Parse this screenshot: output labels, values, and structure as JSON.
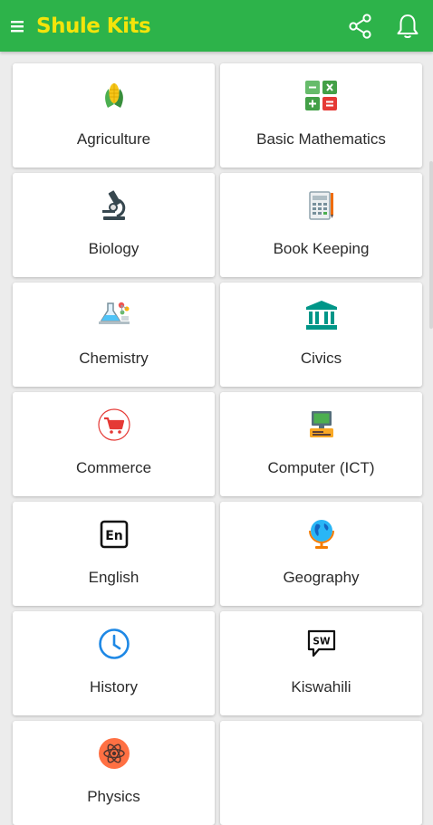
{
  "app": {
    "title": "Shule Kits",
    "brand_color": "#2db34a",
    "title_color": "#f4e40b"
  },
  "toolbar": {
    "menu_icon": "hamburger-menu-icon",
    "share_icon": "share-icon",
    "bell_icon": "bell-icon"
  },
  "subjects": [
    {
      "label": "Agriculture",
      "icon": "corn-icon"
    },
    {
      "label": "Basic Mathematics",
      "icon": "math-operators-icon"
    },
    {
      "label": "Biology",
      "icon": "microscope-icon"
    },
    {
      "label": "Book Keeping",
      "icon": "ledger-icon"
    },
    {
      "label": "Chemistry",
      "icon": "chemistry-flask-icon"
    },
    {
      "label": "Civics",
      "icon": "government-building-icon"
    },
    {
      "label": "Commerce",
      "icon": "shopping-cart-icon"
    },
    {
      "label": "Computer (ICT)",
      "icon": "computer-icon"
    },
    {
      "label": "English",
      "icon": "english-en-icon"
    },
    {
      "label": "Geography",
      "icon": "globe-icon"
    },
    {
      "label": "History",
      "icon": "clock-icon"
    },
    {
      "label": "Kiswahili",
      "icon": "kiswahili-sw-icon"
    },
    {
      "label": "Physics",
      "icon": "atom-icon"
    }
  ]
}
